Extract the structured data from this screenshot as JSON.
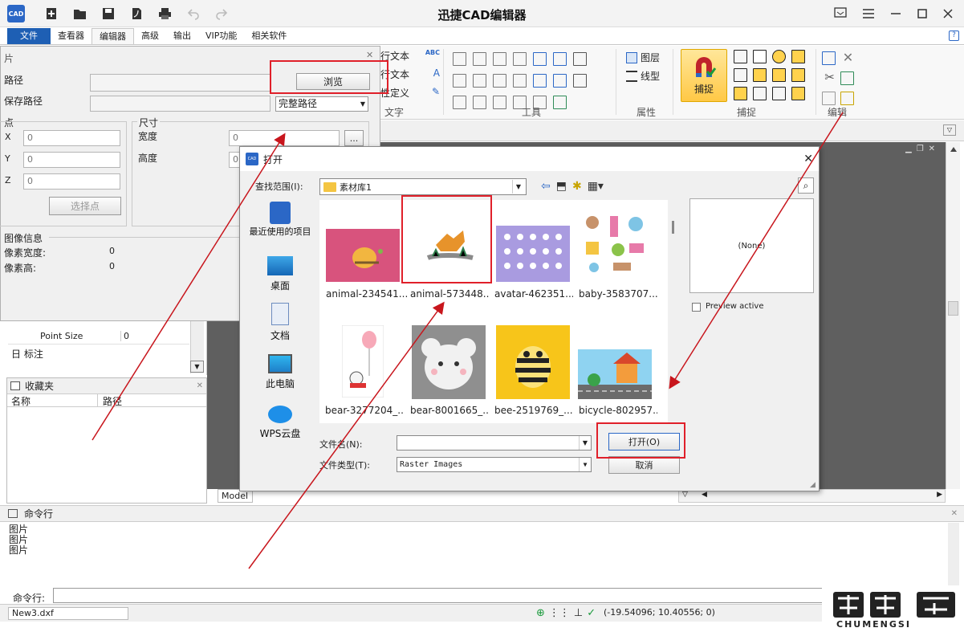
{
  "titlebar": {
    "title": "迅捷CAD编辑器",
    "logo_text": "CAD"
  },
  "menu_tabs": [
    "文件",
    "查看器",
    "编辑器",
    "高级",
    "输出",
    "VIP功能",
    "相关软件"
  ],
  "ribbon": {
    "text_group": {
      "items": [
        "行文本",
        "行文本",
        "性定义"
      ],
      "label": "文字"
    },
    "tools_label": "工具",
    "props": {
      "layer": "图层",
      "linetype": "线型",
      "label": "属性"
    },
    "snap": {
      "button": "捕捉",
      "label": "捕捉"
    },
    "edit_label": "编辑"
  },
  "image_panel": {
    "partial_title": "片",
    "path_label": "路径",
    "save_path_label": "保存路径",
    "browse_btn": "浏览",
    "path_mode": "完整路径",
    "point_label": "点",
    "x_label": "X",
    "y_label": "Y",
    "z_label": "Z",
    "x_val": "0",
    "y_val": "0",
    "z_val": "0",
    "select_point_btn": "选择点",
    "size_label": "尺寸",
    "width_label": "宽度",
    "height_label": "高度",
    "width_val": "0",
    "height_val": "0",
    "ellipsis_btn": "...",
    "info_label": "图像信息",
    "px_width_label": "像素宽度:",
    "px_width_val": "0",
    "px_height_label": "像素高:",
    "px_height_val": "0"
  },
  "props_panel": {
    "point_size_label": "Point Size",
    "point_size_val": "0",
    "annot_label": "日 标注"
  },
  "favorites": {
    "title": "收藏夹",
    "col_name": "名称",
    "col_path": "路径"
  },
  "command": {
    "title": "命令行",
    "history": [
      "图片",
      "图片",
      "图片"
    ],
    "prompt_label": "命令行:"
  },
  "status": {
    "file": "New3.dxf",
    "coords": "(-19.54096; 10.40556; 0)"
  },
  "model_tab": "Model",
  "dialog": {
    "title": "打开",
    "look_in_label": "查找范围(I):",
    "look_in_value": "素材库1",
    "nav": [
      "最近使用的项目",
      "桌面",
      "文档",
      "此电脑",
      "WPS云盘"
    ],
    "files": [
      "animal-234541...",
      "animal-573448...",
      "avatar-462351...",
      "baby-3583707...",
      "bear-3277204_...",
      "bear-8001665_...",
      "bee-2519769_...",
      "bicycle-802957..."
    ],
    "preview_text": "(None)",
    "preview_active_label": "Preview active",
    "filename_label": "文件名(N):",
    "filename_value": "",
    "filetype_label": "文件类型(T):",
    "filetype_value": "Raster Images",
    "open_btn": "打开(O)",
    "cancel_btn": "取消"
  },
  "watermark": {
    "brand": "CHUMENGSI"
  },
  "colors": {
    "accent_blue": "#1e5fb4",
    "highlight_red": "#e0202a",
    "arrow_red": "#c8161d"
  }
}
